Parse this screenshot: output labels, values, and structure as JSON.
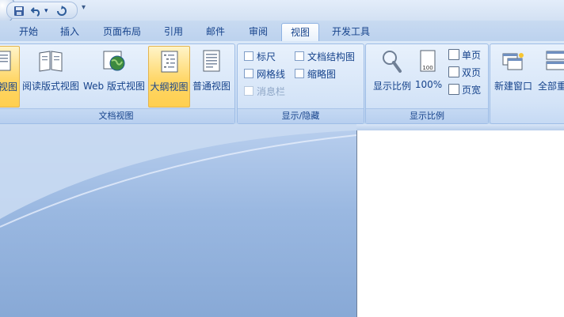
{
  "qat": {
    "icons": [
      "office-button-icon",
      "save-icon",
      "undo-icon",
      "redo-icon",
      "customize-qat-icon"
    ],
    "undo_arrow": "▾",
    "more": "▾"
  },
  "tabs": [
    {
      "label": "开始",
      "active": false
    },
    {
      "label": "插入",
      "active": false
    },
    {
      "label": "页面布局",
      "active": false
    },
    {
      "label": "引用",
      "active": false
    },
    {
      "label": "邮件",
      "active": false
    },
    {
      "label": "审阅",
      "active": false
    },
    {
      "label": "视图",
      "active": true
    },
    {
      "label": "开发工具",
      "active": false
    }
  ],
  "ribbon": {
    "doc_views": {
      "label": "文档视图",
      "buttons": [
        {
          "label": "视图",
          "icon": "page-layout-icon",
          "active": true
        },
        {
          "label": "阅读版式视图",
          "icon": "reading-layout-icon",
          "active": false
        },
        {
          "label": "Web 版式视图",
          "icon": "web-layout-icon",
          "active": false
        },
        {
          "label": "大纲视图",
          "icon": "outline-icon",
          "active": true
        },
        {
          "label": "普通视图",
          "icon": "draft-icon",
          "active": false
        }
      ]
    },
    "show_hide": {
      "label": "显示/隐藏",
      "checks": [
        {
          "label": "标尺",
          "checked": false,
          "disabled": false
        },
        {
          "label": "网格线",
          "checked": false,
          "disabled": false
        },
        {
          "label": "消息栏",
          "checked": false,
          "disabled": true
        },
        {
          "label": "文档结构图",
          "checked": false,
          "disabled": false
        },
        {
          "label": "缩略图",
          "checked": false,
          "disabled": false
        }
      ]
    },
    "zoom": {
      "label": "显示比例",
      "zoom_button": "显示比例",
      "hundred_button": "100%",
      "hundred_icon_text": "100",
      "small_buttons": [
        "单页",
        "双页",
        "页宽"
      ]
    },
    "window": {
      "buttons": [
        {
          "label": "新建窗口",
          "icon": "new-window-icon"
        },
        {
          "label": "全部重",
          "icon": "arrange-all-icon"
        }
      ]
    }
  }
}
